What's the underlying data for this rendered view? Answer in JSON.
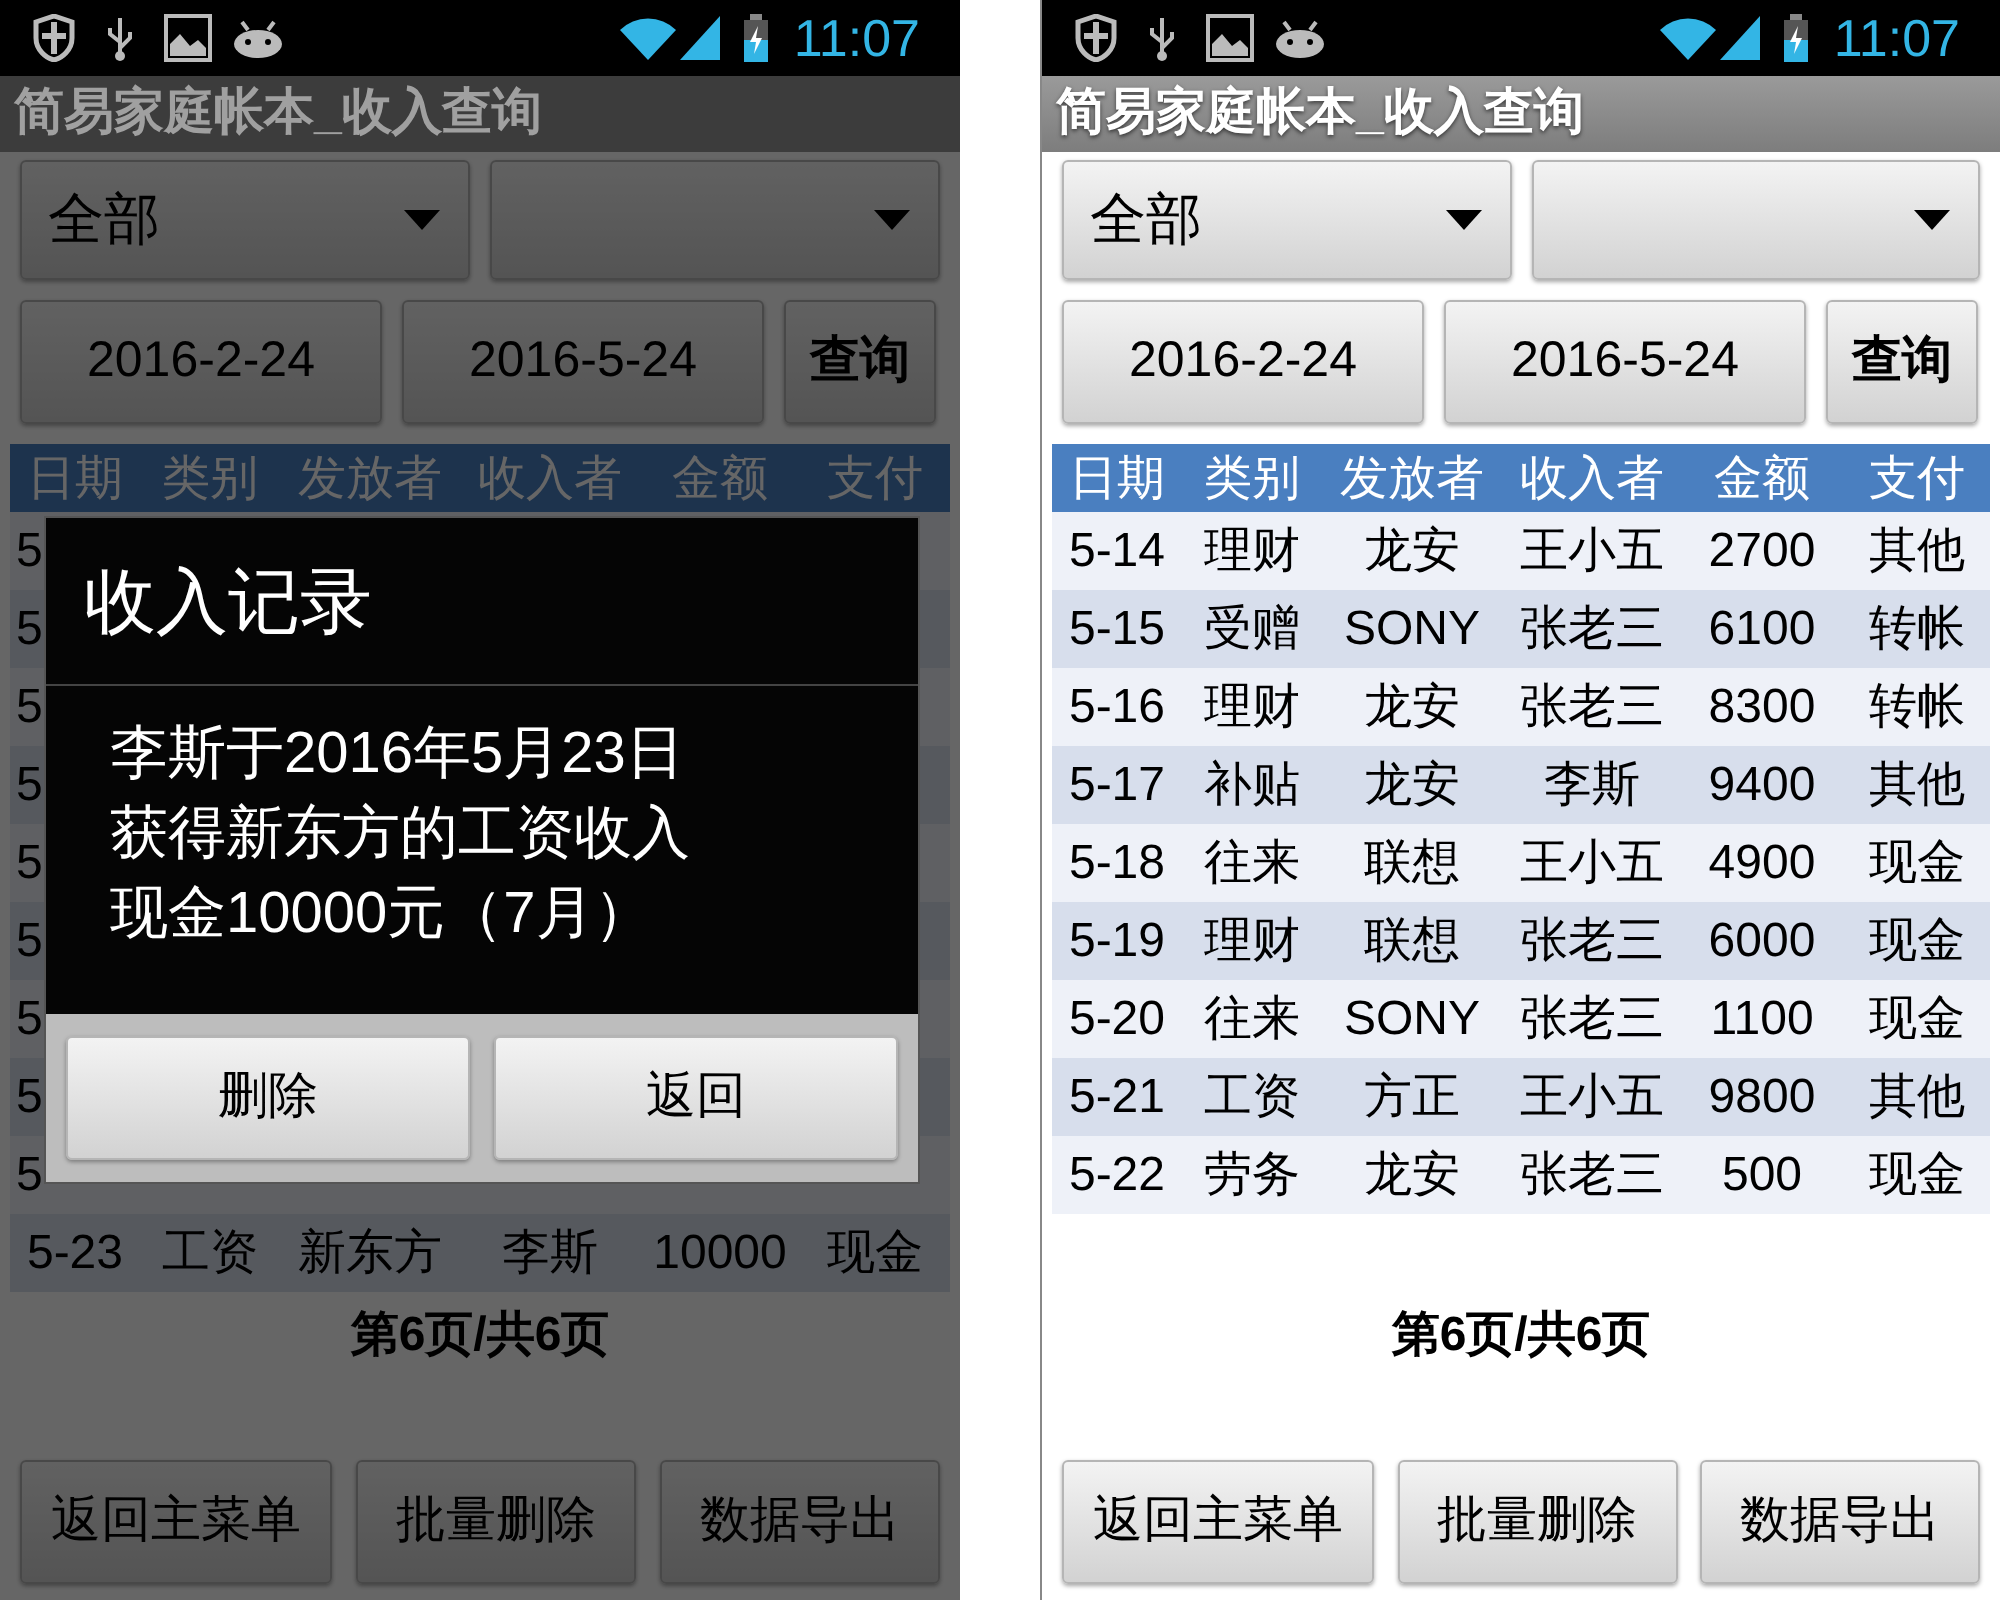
{
  "screens": [
    {
      "status_bar": {
        "time": "11:07"
      },
      "title": "简易家庭帐本_收入查询",
      "filters": [
        {
          "kind": "dropdown",
          "value": "全部"
        },
        {
          "kind": "dropdown"
        }
      ],
      "dates": [
        "2016-2-24",
        "2016-5-24"
      ],
      "query_button": "查询",
      "table": {
        "columns": [
          "日期",
          "类别",
          "发放者",
          "收入者",
          "金额",
          "支付"
        ],
        "rows": [
          [
            "5"
          ],
          [
            "5"
          ],
          [
            "5"
          ],
          [
            "5"
          ],
          [
            "5"
          ],
          [
            "5"
          ],
          [
            "5"
          ],
          [
            "5"
          ],
          [
            "5"
          ],
          [
            "5-23",
            "工资",
            "新东方",
            "李斯",
            "10000",
            "现金"
          ]
        ]
      },
      "page_label": "第6页/共6页",
      "buttons": [
        "返回主菜单",
        "批量删除",
        "数据导出"
      ],
      "dialog": {
        "title": "收入记录",
        "message": [
          "李斯于2016年5月23日",
          "获得新东方的工资收入",
          "现金10000元（7月）"
        ],
        "buttons": [
          "删除",
          "返回"
        ]
      }
    },
    {
      "status_bar": {
        "time": "11:07"
      },
      "title": "简易家庭帐本_收入查询",
      "filters": [
        {
          "kind": "dropdown",
          "value": "全部"
        },
        {
          "kind": "dropdown"
        }
      ],
      "dates": [
        "2016-2-24",
        "2016-5-24"
      ],
      "query_button": "查询",
      "table": {
        "columns": [
          "日期",
          "类别",
          "发放者",
          "收入者",
          "金额",
          "支付"
        ],
        "rows": [
          [
            "5-14",
            "理财",
            "龙安",
            "王小五",
            "2700",
            "其他"
          ],
          [
            "5-15",
            "受赠",
            "SONY",
            "张老三",
            "6100",
            "转帐"
          ],
          [
            "5-16",
            "理财",
            "龙安",
            "张老三",
            "8300",
            "转帐"
          ],
          [
            "5-17",
            "补贴",
            "龙安",
            "李斯",
            "9400",
            "其他"
          ],
          [
            "5-18",
            "往来",
            "联想",
            "王小五",
            "4900",
            "现金"
          ],
          [
            "5-19",
            "理财",
            "联想",
            "张老三",
            "6000",
            "现金"
          ],
          [
            "5-20",
            "往来",
            "SONY",
            "张老三",
            "1100",
            "现金"
          ],
          [
            "5-21",
            "工资",
            "方正",
            "王小五",
            "9800",
            "其他"
          ],
          [
            "5-22",
            "劳务",
            "龙安",
            "张老三",
            "500",
            "现金"
          ]
        ]
      },
      "page_label": "第6页/共6页",
      "buttons": [
        "返回主菜单",
        "批量删除",
        "数据导出"
      ]
    }
  ]
}
